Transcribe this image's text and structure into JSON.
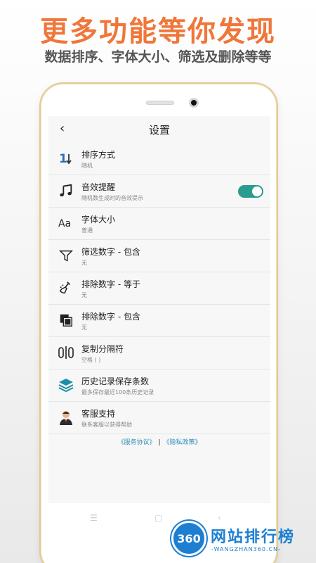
{
  "promo": {
    "title": "更多功能等你发现",
    "subtitle": "数据排序、字体大小、筛选及删除等等"
  },
  "header": {
    "back_icon": "back-arrow-icon",
    "title": "设置"
  },
  "settings": [
    {
      "id": "sort",
      "icon": "sort-icon",
      "title": "排序方式",
      "sub": "随机"
    },
    {
      "id": "sound",
      "icon": "music-note-icon",
      "title": "音效提醒",
      "sub": "随机数生成时的音效提示",
      "toggle": true
    },
    {
      "id": "font",
      "icon": "font-size-icon",
      "title": "字体大小",
      "sub": "普通"
    },
    {
      "id": "filter",
      "icon": "filter-icon",
      "title": "筛选数字 - 包含",
      "sub": "无"
    },
    {
      "id": "exclude-equal",
      "icon": "broom-icon",
      "title": "排除数字 - 等于",
      "sub": "无"
    },
    {
      "id": "exclude-contain",
      "icon": "copy-squares-icon",
      "title": "排除数字 - 包含",
      "sub": "无"
    },
    {
      "id": "separator",
      "icon": "separator-icon",
      "title": "复制分隔符",
      "sub": "空格 ( )"
    },
    {
      "id": "history",
      "icon": "layers-icon",
      "title": "历史记录保存条数",
      "sub": "最多保存最近100条历史记录"
    },
    {
      "id": "support",
      "icon": "support-agent-icon",
      "title": "客服支持",
      "sub": "联系客服以获得帮助"
    }
  ],
  "footer": {
    "terms": "《服务协议》",
    "separator": "|",
    "privacy": "《隐私政策》"
  },
  "watermark": {
    "badge": "360",
    "name": "网站排行榜",
    "url": "-WANGZHAN360.CN-"
  },
  "colors": {
    "promo": "#f0763a",
    "toggle_on": "#2a9d8f",
    "link": "#2b8fb6",
    "watermark": "#1e7fd2"
  }
}
